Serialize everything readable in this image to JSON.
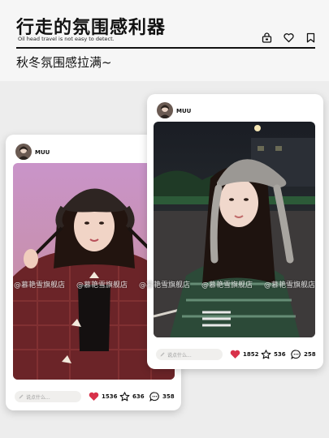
{
  "header": {
    "title": "行走的氛围感利器",
    "subtitle_en": "Oil head travel is not easy to detect.",
    "subtitle": "秋冬氛围感拉满~",
    "icons": [
      "bag-icon",
      "heart-outline-icon",
      "bookmark-icon"
    ]
  },
  "posts": [
    {
      "username": "MUU",
      "comment_placeholder": "说点什么...",
      "likes": "1536",
      "favorites": "636",
      "comments": "358"
    },
    {
      "username": "MUU",
      "comment_placeholder": "说点什么...",
      "likes": "1852",
      "favorites": "536",
      "comments": "258"
    }
  ],
  "watermark": {
    "items": [
      "@慕艳雪旗舰店",
      "@慕艳雪旗舰店",
      "@慕艳雪旗舰店",
      "@慕艳雪旗舰店",
      "@慕艳雪旗舰店"
    ]
  },
  "colors": {
    "accent_heart": "#d8314a",
    "text": "#111111",
    "background": "#ededed"
  }
}
